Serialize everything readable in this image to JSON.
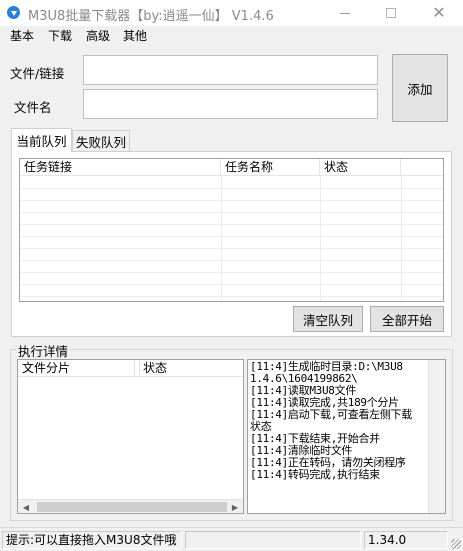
{
  "window": {
    "title": "M3U8批量下载器【by:逍遥一仙】 V1.4.6"
  },
  "menu": [
    "基本",
    "下载",
    "高级",
    "其他"
  ],
  "form": {
    "file_label": "文件/链接",
    "name_label": "文件名",
    "file_value": "",
    "name_value": "",
    "add_button": "添加"
  },
  "tabs": [
    {
      "label": "当前队列",
      "active": true
    },
    {
      "label": "失败队列",
      "active": false
    }
  ],
  "queue_table": {
    "columns": [
      "任务链接",
      "任务名称",
      "状态"
    ],
    "rows": []
  },
  "queue_buttons": {
    "clear": "清空队列",
    "start_all": "全部开始"
  },
  "details": {
    "group_title": "执行详情",
    "columns": [
      "文件分片",
      "状态"
    ]
  },
  "log": [
    "[11:4]生成临时目录:D:\\M3U8",
    "1.4.6\\1604199862\\",
    "[11:4]读取M3U8文件",
    "[11:4]读取完成,共189个分片",
    "[11:4]启动下载,可查看左侧下载",
    "状态",
    "[11:4]下载结束,开始合并",
    "[11:4]清除临时文件",
    "[11:4]正在转码，请勿关闭程序",
    "[11:4]转码完成,执行结束"
  ],
  "status": {
    "hint": "提示:可以直接拖入M3U8文件哦",
    "middle": "",
    "value": "1.34.0"
  },
  "colors": {
    "window_bg": "#f0f0f0",
    "app_icon": "#2b7fd6"
  }
}
